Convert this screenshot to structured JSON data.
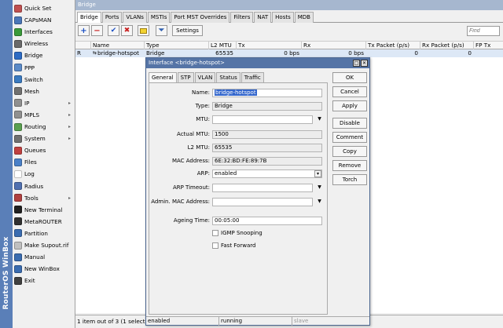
{
  "sidebar": {
    "brand": "RouterOS WinBox",
    "items": [
      {
        "label": "Quick Set",
        "icon": "quickset-icon",
        "color": "#c05050",
        "sub": false
      },
      {
        "label": "CAPsMAN",
        "icon": "capsman-icon",
        "color": "#4a76b8",
        "sub": false
      },
      {
        "label": "Interfaces",
        "icon": "interfaces-icon",
        "color": "#3a9a3a",
        "sub": false
      },
      {
        "label": "Wireless",
        "icon": "wireless-icon",
        "color": "#6a6a6a",
        "sub": false
      },
      {
        "label": "Bridge",
        "icon": "bridge-icon",
        "color": "#2d6bc4",
        "sub": false
      },
      {
        "label": "PPP",
        "icon": "ppp-icon",
        "color": "#5a8ac8",
        "sub": false
      },
      {
        "label": "Switch",
        "icon": "switch-icon",
        "color": "#3a7ac0",
        "sub": false
      },
      {
        "label": "Mesh",
        "icon": "mesh-icon",
        "color": "#707070",
        "sub": false
      },
      {
        "label": "IP",
        "icon": "ip-icon",
        "color": "#909090",
        "sub": true
      },
      {
        "label": "MPLS",
        "icon": "mpls-icon",
        "color": "#909090",
        "sub": true
      },
      {
        "label": "Routing",
        "icon": "routing-icon",
        "color": "#5aa050",
        "sub": true
      },
      {
        "label": "System",
        "icon": "system-icon",
        "color": "#707070",
        "sub": true
      },
      {
        "label": "Queues",
        "icon": "queues-icon",
        "color": "#c04040",
        "sub": false
      },
      {
        "label": "Files",
        "icon": "files-icon",
        "color": "#4a80c8",
        "sub": false
      },
      {
        "label": "Log",
        "icon": "log-icon",
        "color": "#ffffff",
        "sub": false
      },
      {
        "label": "Radius",
        "icon": "radius-icon",
        "color": "#5070b0",
        "sub": false
      },
      {
        "label": "Tools",
        "icon": "tools-icon",
        "color": "#b04040",
        "sub": true
      },
      {
        "label": "New Terminal",
        "icon": "terminal-icon",
        "color": "#202020",
        "sub": false
      },
      {
        "label": "MetaROUTER",
        "icon": "metarouter-icon",
        "color": "#303030",
        "sub": false
      },
      {
        "label": "Partition",
        "icon": "partition-icon",
        "color": "#3a6cb0",
        "sub": false
      },
      {
        "label": "Make Supout.rif",
        "icon": "supout-icon",
        "color": "#c0c0c0",
        "sub": false
      },
      {
        "label": "Manual",
        "icon": "manual-icon",
        "color": "#3a6cb0",
        "sub": false
      },
      {
        "label": "New WinBox",
        "icon": "winbox-icon",
        "color": "#3a6cb0",
        "sub": false
      },
      {
        "label": "Exit",
        "icon": "exit-icon",
        "color": "#404040",
        "sub": false
      }
    ]
  },
  "bridge": {
    "title": "Bridge",
    "tabs": [
      "Bridge",
      "Ports",
      "VLANs",
      "MSTIs",
      "Port MST Overrides",
      "Filters",
      "NAT",
      "Hosts",
      "MDB"
    ],
    "settings_label": "Settings",
    "find_placeholder": "Find",
    "columns": [
      "Name",
      "Type",
      "L2 MTU",
      "Tx",
      "Rx",
      "Tx Packet (p/s)",
      "Rx Packet (p/s)",
      "FP Tx"
    ],
    "row": {
      "flag": "R",
      "name": "bridge-hotspot",
      "type": "Bridge",
      "l2mtu": "65535",
      "tx": "0 bps",
      "rx": "0 bps",
      "txp": "0",
      "rxp": "0",
      "fptx": ""
    },
    "status": "1 item out of 3 (1 selected)"
  },
  "dialog": {
    "title": "Interface <bridge-hotspot>",
    "tabs": [
      "General",
      "STP",
      "VLAN",
      "Status",
      "Traffic"
    ],
    "fields": {
      "name_label": "Name:",
      "name_value": "bridge-hotspot",
      "type_label": "Type:",
      "type_value": "Bridge",
      "mtu_label": "MTU:",
      "mtu_value": "",
      "actual_mtu_label": "Actual MTU:",
      "actual_mtu_value": "1500",
      "l2mtu_label": "L2 MTU:",
      "l2mtu_value": "65535",
      "mac_label": "MAC Address:",
      "mac_value": "6E:32:BD:FE:89:7B",
      "arp_label": "ARP:",
      "arp_value": "enabled",
      "arp_timeout_label": "ARP Timeout:",
      "arp_timeout_value": "",
      "admin_mac_label": "Admin. MAC Address:",
      "admin_mac_value": "",
      "ageing_label": "Ageing Time:",
      "ageing_value": "00:05:00",
      "igmp_label": "IGMP Snooping",
      "fast_forward_label": "Fast Forward"
    },
    "buttons": [
      "OK",
      "Cancel",
      "Apply",
      "Disable",
      "Comment",
      "Copy",
      "Remove",
      "Torch"
    ],
    "status": [
      "enabled",
      "running",
      "slave"
    ]
  }
}
